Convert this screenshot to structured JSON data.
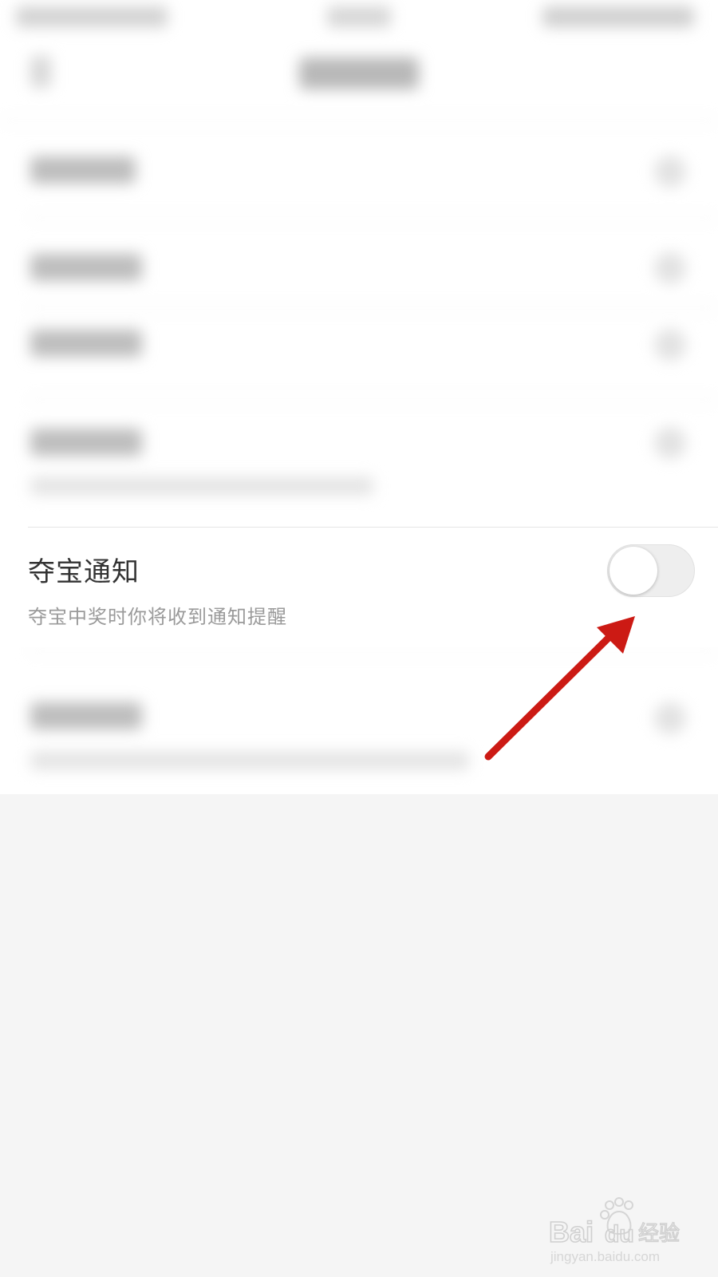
{
  "notification_row": {
    "title": "夺宝通知",
    "subtitle": "夺宝中奖时你将收到通知提醒",
    "toggle_on": false
  },
  "colors": {
    "page_background": "#f5f5f5",
    "card_background": "#ffffff",
    "title_text": "#333333",
    "subtitle_text": "#9a9a9a",
    "toggle_track_off": "#eeeeee",
    "annotation_arrow": "#cc1a14"
  },
  "watermark": {
    "brand": "Baidu 经验",
    "url": "jingyan.baidu.com"
  }
}
